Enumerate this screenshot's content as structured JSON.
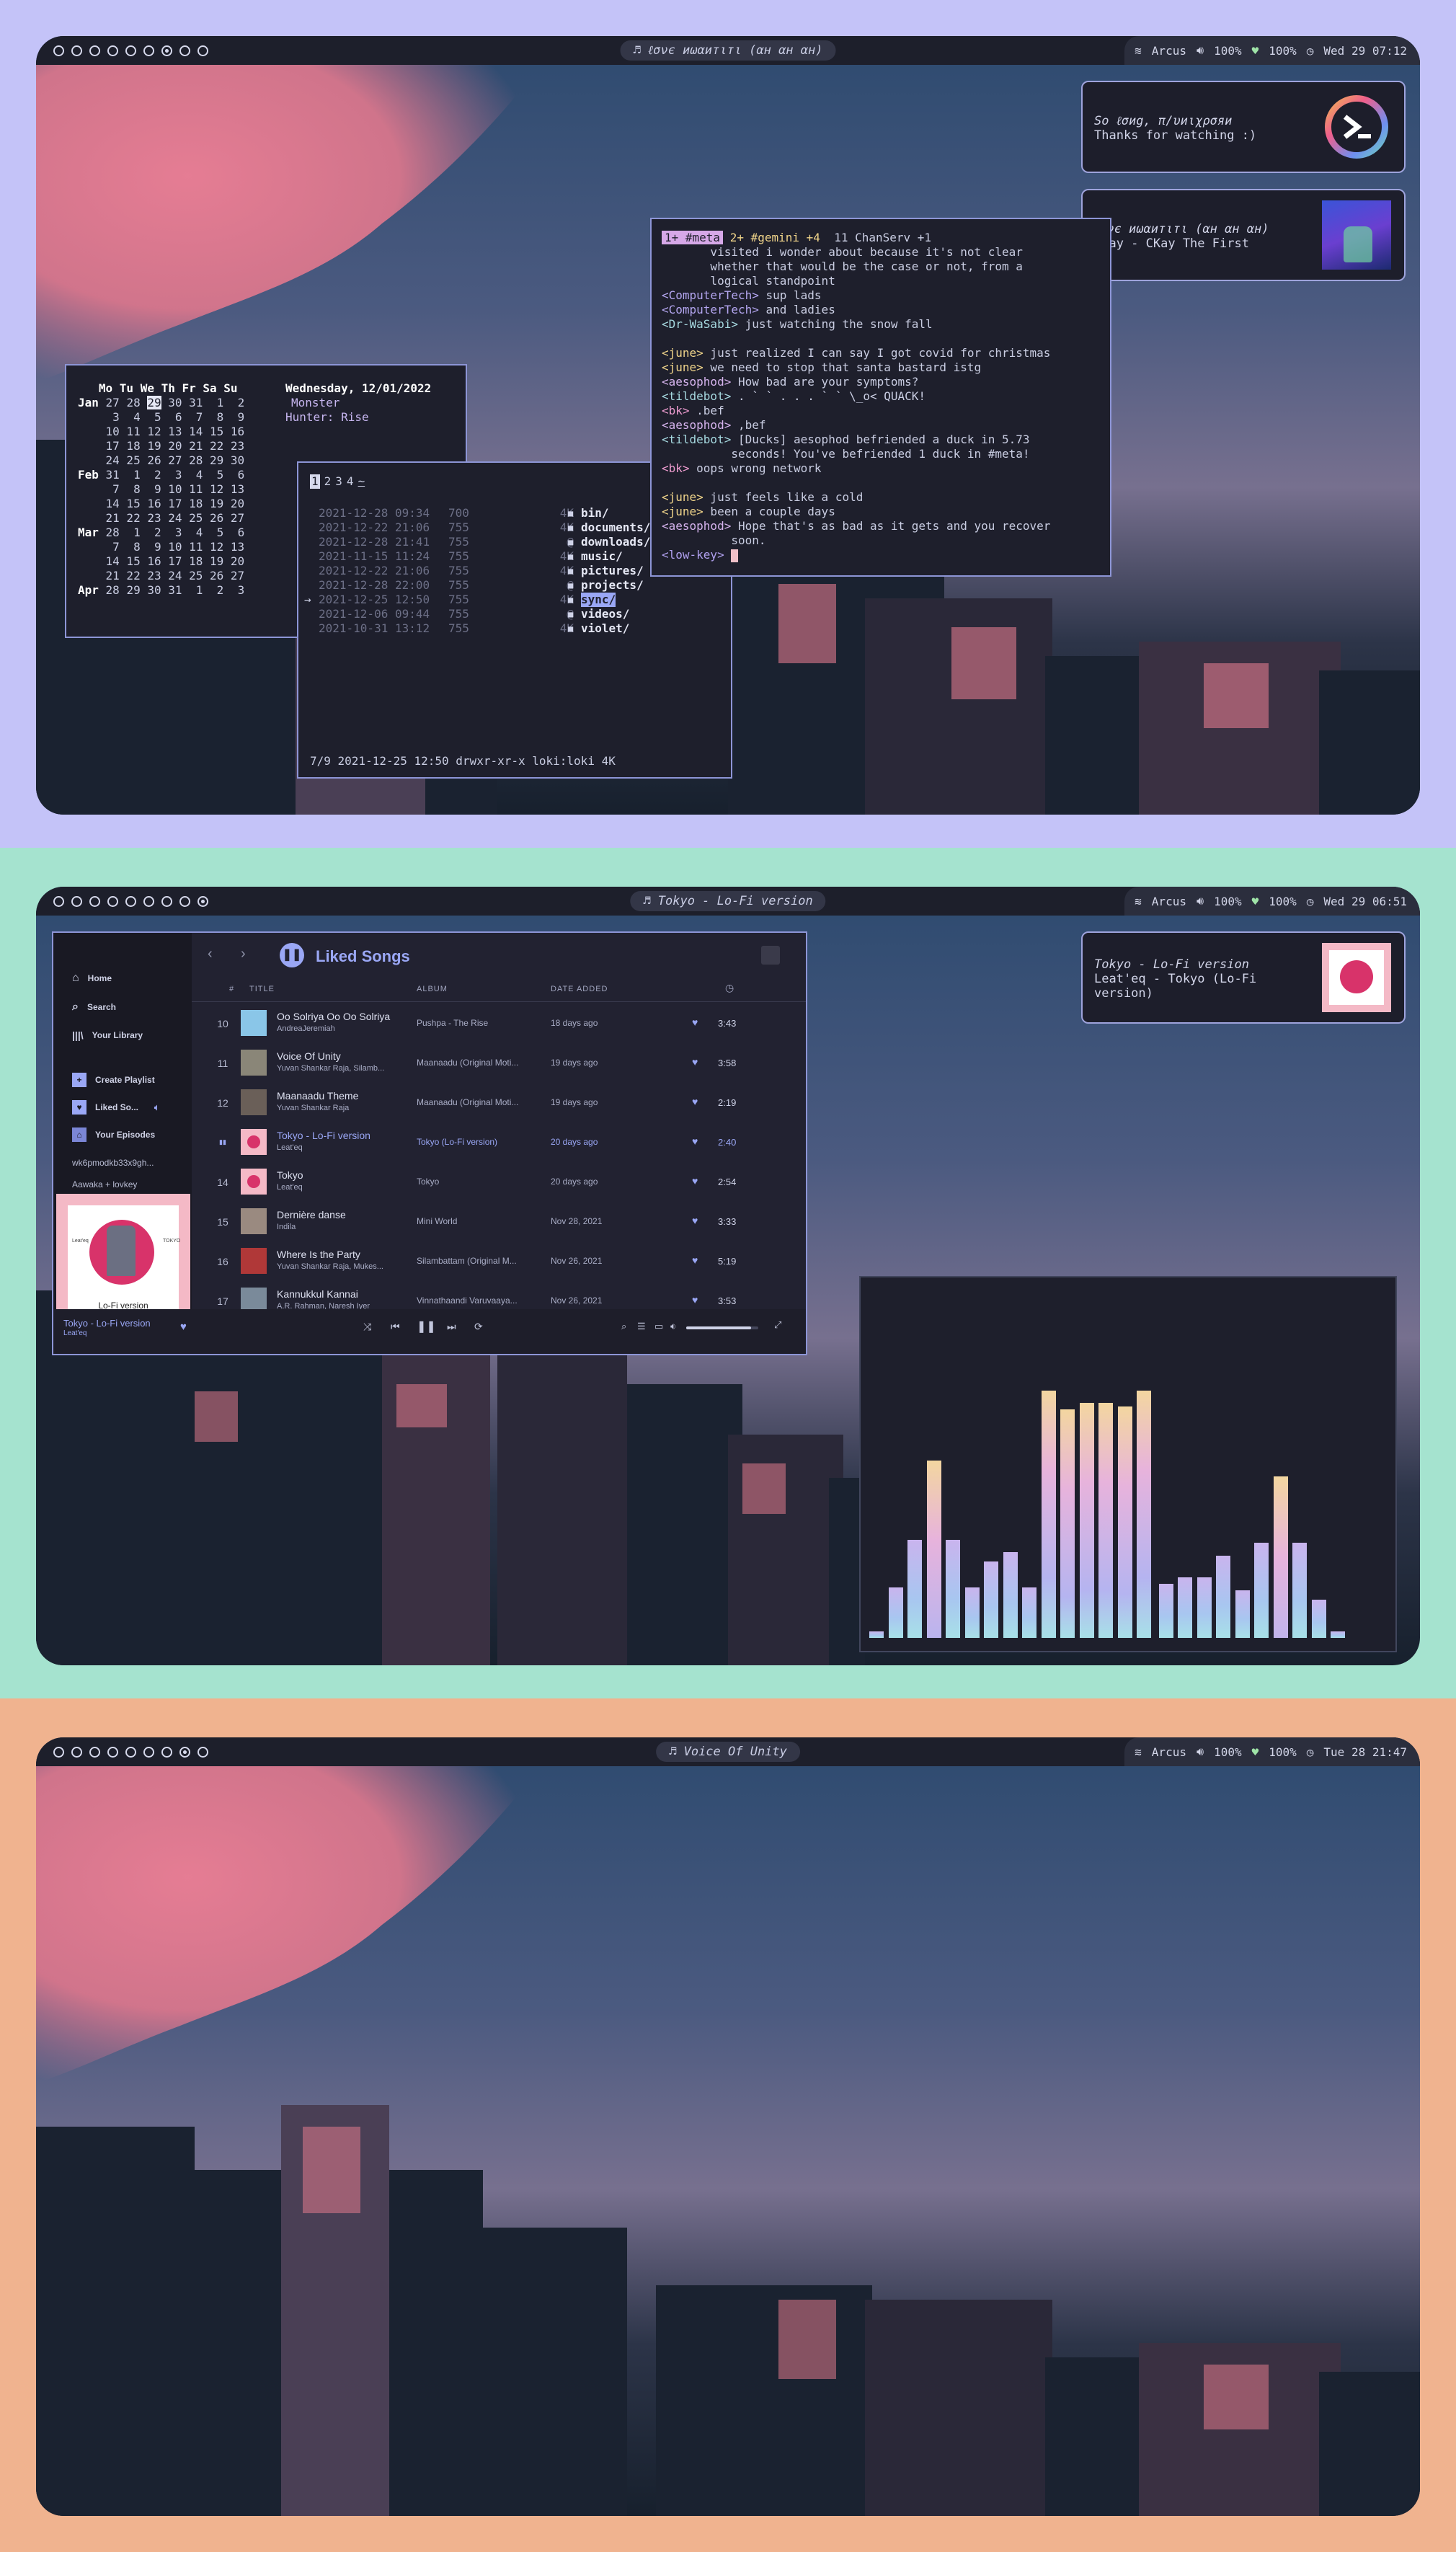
{
  "screens": [
    {
      "bar": {
        "title": "ℓσνє иωαитιтι (αн αн αн)",
        "wifi": "Arcus",
        "volume": "100%",
        "battery": "100%",
        "clock": "Wed 29 07:12"
      },
      "notifications": [
        {
          "line1": "So ℓσиg, π/υиιχρσяи",
          "line2": "Thanks for watching :)"
        },
        {
          "line1": "ℓσνє иωαитιтι (αн αн αн)",
          "line2": "CKay - CKay The First"
        }
      ],
      "calendar": {
        "header": "   Mo Tu We Th Fr Sa Su",
        "rows": [
          "Jan 27 28 29 30 31  1  2",
          "     3  4  5  6  7  8  9",
          "    10 11 12 13 14 15 16",
          "    17 18 19 20 21 22 23",
          "    24 25 26 27 28 29 30",
          "Feb 31  1  2  3  4  5  6",
          "     7  8  9 10 11 12 13",
          "    14 15 16 17 18 19 20",
          "    21 22 23 24 25 26 27",
          "Mar 28  1  2  3  4  5  6",
          "     7  8  9 10 11 12 13",
          "    14 15 16 17 18 19 20",
          "    21 22 23 24 25 26 27",
          "Apr 28 29 30 31  1  2  3"
        ],
        "date": "Wednesday, 12/01/2022",
        "moon": "Monster",
        "hunter": "Hunter: Rise"
      },
      "filemanager": {
        "tabs": [
          "1",
          "2",
          "3",
          "4",
          "~"
        ],
        "rows": [
          {
            "date": "2021-12-28 09:34",
            "perm": "700",
            "size": "4K",
            "name": "bin/"
          },
          {
            "date": "2021-12-22 21:06",
            "perm": "755",
            "size": "4K",
            "name": "documents/"
          },
          {
            "date": "2021-12-28 21:41",
            "perm": "755",
            "size": "@",
            "name": "downloads/"
          },
          {
            "date": "2021-11-15 11:24",
            "perm": "755",
            "size": "4K",
            "name": "music/"
          },
          {
            "date": "2021-12-22 21:06",
            "perm": "755",
            "size": "4K",
            "name": "pictures/"
          },
          {
            "date": "2021-12-28 22:00",
            "perm": "755",
            "size": "@",
            "name": "projects/"
          },
          {
            "date": "2021-12-25 12:50",
            "perm": "755",
            "size": "4K",
            "name": "sync/"
          },
          {
            "date": "2021-12-06 09:44",
            "perm": "755",
            "size": "@",
            "name": "videos/"
          },
          {
            "date": "2021-10-31 13:12",
            "perm": "755",
            "size": "4K",
            "name": "violet/"
          }
        ],
        "status": "7/9 2021-12-25 12:50 drwxr-xr-x loki:loki 4K"
      },
      "irc": {
        "tab1": "1+ #meta",
        "tab2": "2+ #gemini +4",
        "tab3": "11 ChanServ +1",
        "lines": [
          {
            "nick": "",
            "text": "       visited i wonder about because it's not clear"
          },
          {
            "nick": "",
            "text": "       whether that would be the case or not, from a"
          },
          {
            "nick": "",
            "text": "       logical standpoint"
          },
          {
            "nick": "<ComputerTech>",
            "text": " sup lads"
          },
          {
            "nick": "<ComputerTech>",
            "text": " and ladies"
          },
          {
            "nick": "<Dr-WaSabi>",
            "text": " just watching the snow fall"
          },
          {
            "nick": "",
            "text": " "
          },
          {
            "nick": "<june>",
            "text": " just realized I can say I got covid for christmas"
          },
          {
            "nick": "<june>",
            "text": " we need to stop that santa bastard istg"
          },
          {
            "nick": "<aesophod>",
            "text": " How bad are your symptoms?"
          },
          {
            "nick": "<tildebot>",
            "text": " . ` ` . . . ` ` \\_o< QUACK!"
          },
          {
            "nick": "<bk>",
            "text": " .bef"
          },
          {
            "nick": "<aesophod>",
            "text": " ,bef"
          },
          {
            "nick": "<tildebot>",
            "text": " [Ducks] aesophod befriended a duck in 5.73"
          },
          {
            "nick": "",
            "text": "          seconds! You've befriended 1 duck in #meta!"
          },
          {
            "nick": "<bk>",
            "text": " oops wrong network"
          },
          {
            "nick": "",
            "text": " "
          },
          {
            "nick": "<june>",
            "text": " just feels like a cold"
          },
          {
            "nick": "<june>",
            "text": " been a couple days"
          },
          {
            "nick": "<aesophod>",
            "text": " Hope that's as bad as it gets and you recover"
          },
          {
            "nick": "",
            "text": "          soon."
          },
          {
            "nick": "<low-key>",
            "text": " "
          }
        ]
      }
    },
    {
      "bar": {
        "title": "Tokyo - Lo-Fi version",
        "wifi": "Arcus",
        "volume": "100%",
        "battery": "100%",
        "clock": "Wed 29 06:51"
      },
      "notification": {
        "line1": "Tokyo - Lo-Fi version",
        "line2": "Leat'eq - Tokyo (Lo-Fi",
        "line3": "version)"
      },
      "spotify": {
        "nav": {
          "home": "Home",
          "search": "Search",
          "library": "Your Library",
          "create": "Create Playlist",
          "liked": "Liked So...",
          "episodes": "Your Episodes",
          "pl1": "wk6pmodkb33x9gh...",
          "pl2": "Aawaka + lovkey"
        },
        "heading": "Liked Songs",
        "cols": {
          "num": "#",
          "title": "TITLE",
          "album": "ALBUM",
          "added": "DATE ADDED"
        },
        "rows": [
          {
            "n": "10",
            "title": "Oo Solriya Oo Oo Solriya",
            "artist": "AndreaJeremiah",
            "album": "Pushpa - The Rise",
            "added": "18 days ago",
            "dur": "3:43"
          },
          {
            "n": "11",
            "title": "Voice Of Unity",
            "artist": "Yuvan Shankar Raja, Silamb...",
            "album": "Maanaadu (Original Moti...",
            "added": "19 days ago",
            "dur": "3:58"
          },
          {
            "n": "12",
            "title": "Maanaadu Theme",
            "artist": "Yuvan Shankar Raja",
            "album": "Maanaadu (Original Moti...",
            "added": "19 days ago",
            "dur": "2:19"
          },
          {
            "n": "",
            "title": "Tokyo - Lo-Fi version",
            "artist": "Leat'eq",
            "album": "Tokyo (Lo-Fi version)",
            "added": "20 days ago",
            "dur": "2:40"
          },
          {
            "n": "14",
            "title": "Tokyo",
            "artist": "Leat'eq",
            "album": "Tokyo",
            "added": "20 days ago",
            "dur": "2:54"
          },
          {
            "n": "15",
            "title": "Dernière danse",
            "artist": "Indila",
            "album": "Mini World",
            "added": "Nov 28, 2021",
            "dur": "3:33"
          },
          {
            "n": "16",
            "title": "Where Is the Party",
            "artist": "Yuvan Shankar Raja, Mukes...",
            "album": "Silambattam (Original M...",
            "added": "Nov 26, 2021",
            "dur": "5:19"
          },
          {
            "n": "17",
            "title": "Kannukkul Kannai",
            "artist": "A.R. Rahman, Naresh Iyer",
            "album": "Vinnathaandi Varuvaaya...",
            "added": "Nov 26, 2021",
            "dur": "3:53"
          }
        ],
        "cover_text": "Lo-Fi version",
        "cover_left": "Leat'eq",
        "cover_right": "TOKYO",
        "now_title": "Tokyo - Lo-Fi version",
        "now_artist": "Leat'eq",
        "progress": 0.13,
        "volume": 0.9
      },
      "visualizer": {
        "levels": [
          0.02,
          0.16,
          0.31,
          0.56,
          0.31,
          0.16,
          0.24,
          0.27,
          0.16,
          0.78,
          0.72,
          0.74,
          0.74,
          0.73,
          0.78,
          0.17,
          0.19,
          0.19,
          0.26,
          0.15,
          0.3,
          0.51,
          0.3,
          0.12,
          0.02
        ]
      }
    },
    {
      "bar": {
        "title": "Voice Of Unity",
        "wifi": "Arcus",
        "volume": "100%",
        "battery": "100%",
        "clock": "Tue 28 21:47"
      }
    }
  ],
  "colors": {
    "accent": "#9aa7f5",
    "bar": "#1d1f2b",
    "border": "#8d95d6",
    "band1": "#c4c3f8",
    "band2": "#a5e3cf",
    "band3": "#f0b38f"
  }
}
